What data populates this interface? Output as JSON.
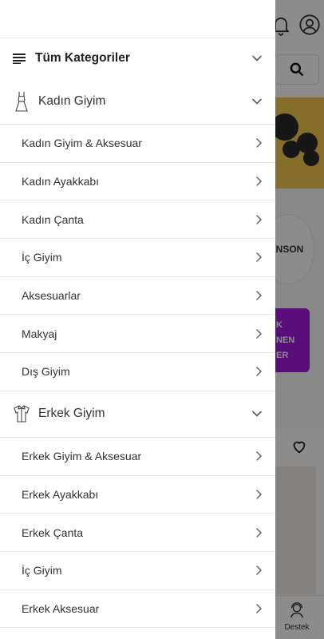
{
  "header": {
    "close_icon": "close-icon"
  },
  "all_categories": {
    "label": "Tüm Kategoriler",
    "icon": "menu-list-icon"
  },
  "groups": [
    {
      "label": "Kadın Giyim",
      "icon": "dress-icon",
      "expanded": true,
      "items": [
        {
          "label": "Kadın Giyim & Aksesuar"
        },
        {
          "label": "Kadın Ayakkabı"
        },
        {
          "label": "Kadın Çanta"
        },
        {
          "label": "İç Giyim"
        },
        {
          "label": "Aksesuarlar"
        },
        {
          "label": "Makyaj"
        },
        {
          "label": "Dış Giyim"
        }
      ]
    },
    {
      "label": "Erkek Giyim",
      "icon": "shirt-icon",
      "expanded": true,
      "items": [
        {
          "label": "Erkek Giyim & Aksesuar"
        },
        {
          "label": "Erkek Ayakkabı"
        },
        {
          "label": "Erkek Çanta"
        },
        {
          "label": "İç Giyim"
        },
        {
          "label": "Erkek Aksesuar"
        }
      ]
    }
  ],
  "background": {
    "brand_text": "ANSON",
    "promo_text": [
      "K",
      "NEN",
      "ER"
    ],
    "tab_destek": "Destek",
    "promo_color": "#a21be0",
    "banner_color": "#f2c84b"
  }
}
